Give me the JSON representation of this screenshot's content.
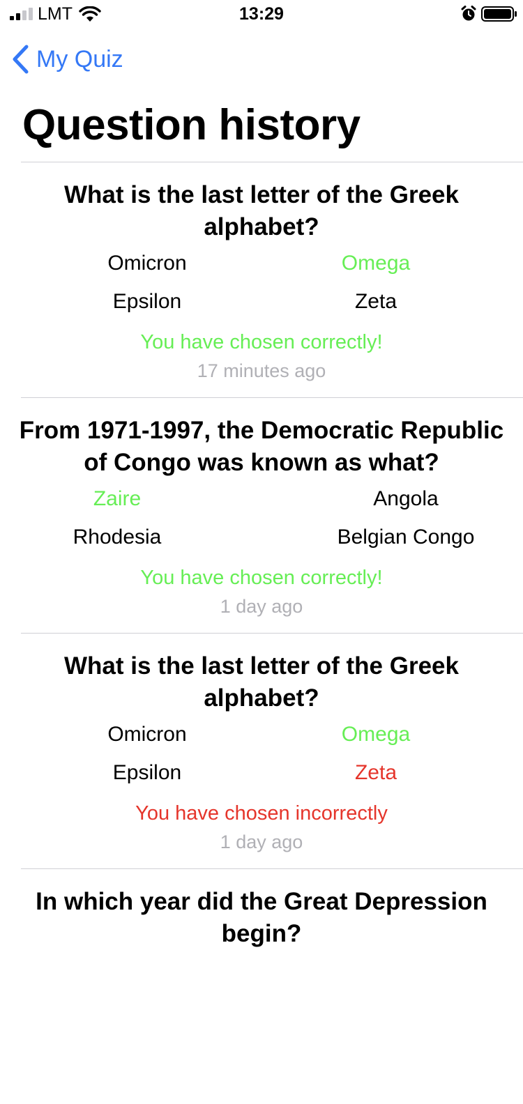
{
  "status": {
    "carrier": "LMT",
    "time": "13:29"
  },
  "nav": {
    "back_label": "My Quiz"
  },
  "page_title": "Question history",
  "history": [
    {
      "question": "What is the last letter of the Greek alphabet?",
      "answers": [
        "Omicron",
        "Omega",
        "Epsilon",
        "Zeta"
      ],
      "result": "You have chosen correctly!",
      "time_ago": "17 minutes ago"
    },
    {
      "question": "From 1971-1997, the Democratic Republic of Congo was known as what?",
      "answers": [
        "Zaire",
        "Angola",
        "Rhodesia",
        "Belgian Congo"
      ],
      "result": "You have chosen correctly!",
      "time_ago": "1 day ago"
    },
    {
      "question": "What is the last letter of the Greek alphabet?",
      "answers": [
        "Omicron",
        "Omega",
        "Epsilon",
        "Zeta"
      ],
      "result": "You have chosen incorrectly",
      "time_ago": "1 day ago"
    },
    {
      "question": "In which year did the Great Depression begin?"
    }
  ],
  "colors": {
    "accent": "#3478f6",
    "correct": "#66ee55",
    "incorrect": "#e5352b",
    "muted": "#b0b0b5"
  }
}
